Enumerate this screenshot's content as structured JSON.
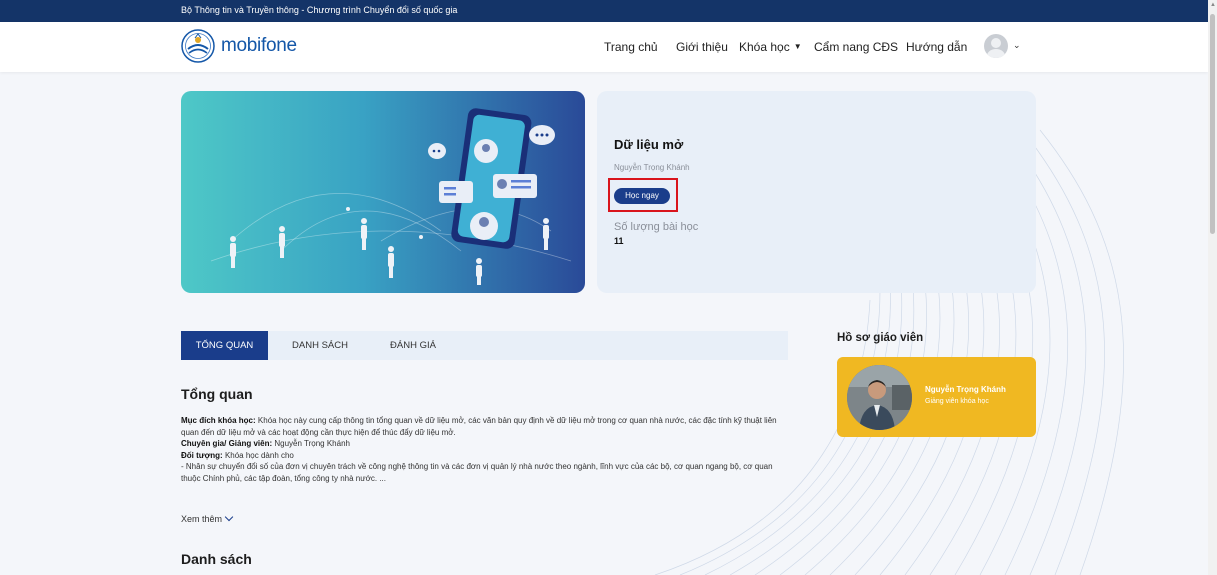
{
  "top_strip": {
    "text": "Bộ Thông tin và Truyền thông - Chương trình Chuyển đổi số quốc gia"
  },
  "header": {
    "logo_text": "mobifone",
    "nav": [
      {
        "label": "Trang chủ"
      },
      {
        "label": "Giới thiệu"
      },
      {
        "label": "Khóa học",
        "has_dropdown": true
      },
      {
        "label": "Cẩm nang CĐS"
      },
      {
        "label": "Hướng dẫn"
      }
    ],
    "avatar_icon": "user-avatar-icon"
  },
  "course": {
    "title": "Dữ liệu mở",
    "author": "Nguyễn Trọng Khánh",
    "start_button": "Học ngay",
    "lesson_count_label": "Số lượng bài học",
    "lesson_count": "11"
  },
  "tabs": [
    {
      "label": "TỔNG QUAN",
      "active": true
    },
    {
      "label": "DANH SÁCH",
      "active": false
    },
    {
      "label": "ĐÁNH GIÁ",
      "active": false
    }
  ],
  "overview": {
    "heading": "Tổng quan",
    "purpose_label": "Mục đích khóa học:",
    "purpose_text": "Khóa học này cung cấp thông tin tổng quan về dữ liệu mở, các văn bản quy định về dữ liệu mở trong cơ quan nhà nước, các đặc tính kỹ thuật liên quan đến dữ liệu mở và các hoạt động cần thực hiện để thúc đẩy dữ liệu mở.",
    "expert_label": "Chuyên gia/ Giảng viên:",
    "expert_text": "Nguyễn Trọng Khánh",
    "audience_label": "Đối tượng:",
    "audience_text": "Khóa học dành cho",
    "audience_detail": "- Nhân sự chuyển đổi số của đơn vị chuyên trách về công nghệ thông tin và các đơn vị quản lý nhà nước theo ngành, lĩnh vực của các bộ, cơ quan ngang bộ, cơ quan thuộc Chính phủ, các tập đoàn, tổng công ty nhà nước. ...",
    "read_more": "Xem thêm"
  },
  "list_heading": "Danh sách",
  "teacher": {
    "heading": "Hồ sơ giáo viên",
    "name": "Nguyễn Trọng Khánh",
    "role": "Giảng viên khóa học"
  },
  "colors": {
    "primary": "#1a3d8b",
    "top_strip": "#143468",
    "teacher_card": "#f0b822",
    "highlight": "#d9141c"
  }
}
